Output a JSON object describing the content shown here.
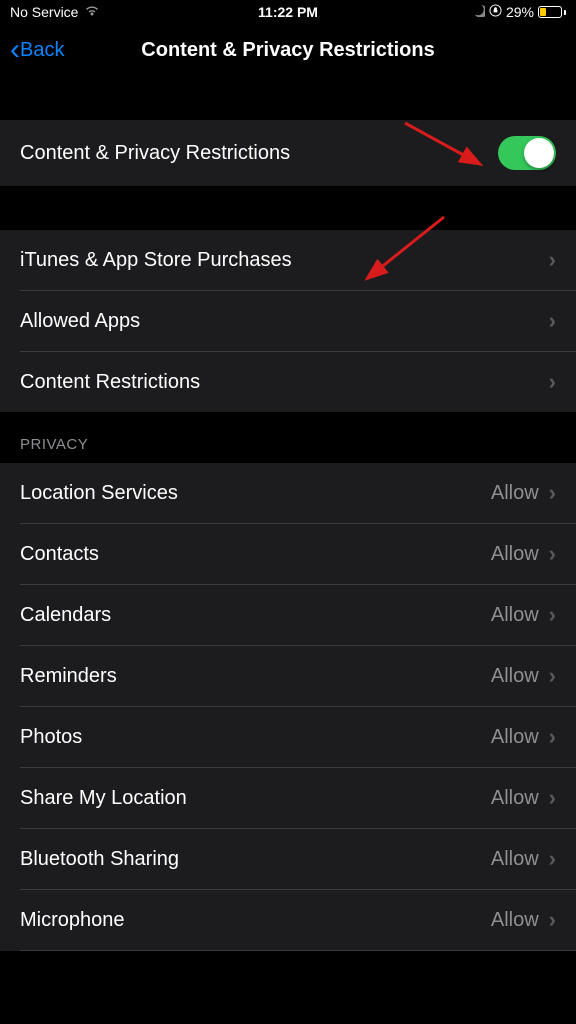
{
  "statusBar": {
    "carrier": "No Service",
    "time": "11:22 PM",
    "batteryPercent": "29%"
  },
  "nav": {
    "back": "Back",
    "title": "Content & Privacy Restrictions"
  },
  "mainToggle": {
    "label": "Content & Privacy Restrictions",
    "on": true
  },
  "group1": [
    {
      "label": "iTunes & App Store Purchases"
    },
    {
      "label": "Allowed Apps"
    },
    {
      "label": "Content Restrictions"
    }
  ],
  "privacyHeader": "PRIVACY",
  "privacyItems": [
    {
      "label": "Location Services",
      "value": "Allow"
    },
    {
      "label": "Contacts",
      "value": "Allow"
    },
    {
      "label": "Calendars",
      "value": "Allow"
    },
    {
      "label": "Reminders",
      "value": "Allow"
    },
    {
      "label": "Photos",
      "value": "Allow"
    },
    {
      "label": "Share My Location",
      "value": "Allow"
    },
    {
      "label": "Bluetooth Sharing",
      "value": "Allow"
    },
    {
      "label": "Microphone",
      "value": "Allow"
    }
  ]
}
